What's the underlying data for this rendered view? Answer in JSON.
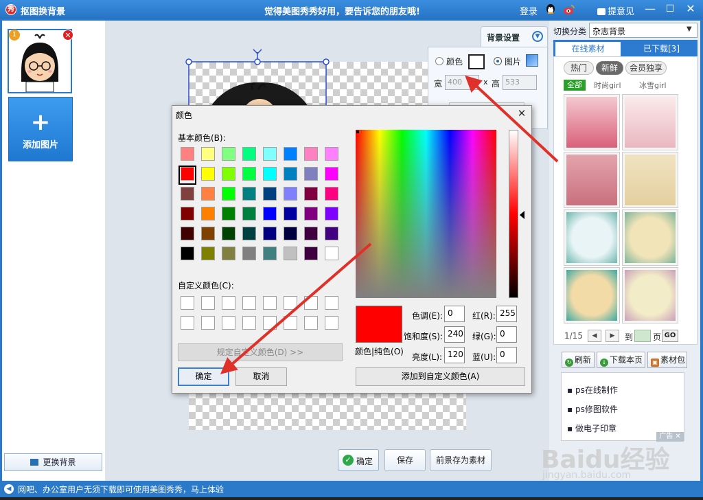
{
  "titlebar": {
    "app_logo": "秀",
    "title": "抠图换背景",
    "slogan": "觉得美图秀秀好用，要告诉您的朋友哦!",
    "login": "登录",
    "feedback": "提意见",
    "icons": [
      "qq-icon",
      "weibo-icon",
      "feedback-icon"
    ]
  },
  "left_panel": {
    "thumb_badge": "1",
    "add_image_plus": "+",
    "add_image_label": "添加图片",
    "change_bg_label": "更换背景"
  },
  "bg_settings": {
    "tab_label": "背景设置",
    "color_label": "颜色",
    "image_label": "图片",
    "width_label": "宽",
    "width_value": "400",
    "x_label": "x",
    "height_label": "高",
    "height_value": "533",
    "selected_mode": "image"
  },
  "canvas_buttons": {
    "confirm": "确定",
    "save": "保存",
    "save_fg": "前景存为素材"
  },
  "right_panel": {
    "category_label": "切换分类",
    "category_value": "杂志背景",
    "tab_online": "在线素材",
    "tab_downloaded": "已下载[3]",
    "pill_hot": "热门",
    "pill_new": "新鲜",
    "pill_vip": "会员独享",
    "filter_all": "全部",
    "filter_fashion": "时尚girl",
    "filter_ice": "冰雪girl",
    "pager_text": "1/15",
    "pager_to": "到",
    "pager_page": "页",
    "pager_go": "GO",
    "refresh": "刷新",
    "download_page": "下载本页",
    "material_pack": "素材包",
    "ad_items": [
      "ps在线制作",
      "ps修图软件",
      "做电子印章"
    ],
    "ad_badge": "广告"
  },
  "status_bar": {
    "text": "网吧、办公室用户无须下载即可使用美图秀秀，马上体验"
  },
  "color_dialog": {
    "title": "颜色",
    "basic_colors_label": "基本颜色(B):",
    "custom_colors_label": "自定义颜色(C):",
    "define_custom_btn": "规定自定义颜色(D) >>",
    "ok": "确定",
    "cancel": "取消",
    "preview_label": "颜色|纯色(O)",
    "hue_label": "色调(E):",
    "hue": "0",
    "sat_label": "饱和度(S):",
    "sat": "240",
    "lum_label": "亮度(L):",
    "lum": "120",
    "red_label": "红(R):",
    "red": "255",
    "green_label": "绿(G):",
    "green": "0",
    "blue_label": "蓝(U):",
    "blue": "0",
    "add_custom": "添加到自定义颜色(A)",
    "basic_colors": [
      "#ff8080",
      "#ffff80",
      "#80ff80",
      "#00ff80",
      "#80ffff",
      "#0080ff",
      "#ff80c0",
      "#ff80ff",
      "#ff0000",
      "#ffff00",
      "#80ff00",
      "#00ff40",
      "#00ffff",
      "#0080c0",
      "#8080c0",
      "#ff00ff",
      "#804040",
      "#ff8040",
      "#00ff00",
      "#008080",
      "#004080",
      "#8080ff",
      "#800040",
      "#ff0080",
      "#800000",
      "#ff8000",
      "#008000",
      "#008040",
      "#0000ff",
      "#0000a0",
      "#800080",
      "#8000ff",
      "#400000",
      "#804000",
      "#004000",
      "#004040",
      "#000080",
      "#000040",
      "#400040",
      "#400080",
      "#000000",
      "#808000",
      "#808040",
      "#808080",
      "#408080",
      "#c0c0c0",
      "#400040",
      "#ffffff"
    ]
  },
  "watermark": {
    "logo": "Baidu经验",
    "url": "jingyan.baidu.com"
  },
  "colors": {
    "accent": "#2b79c9",
    "annotation_arrow": "#e0302a",
    "selected_color": "#ff0000"
  }
}
